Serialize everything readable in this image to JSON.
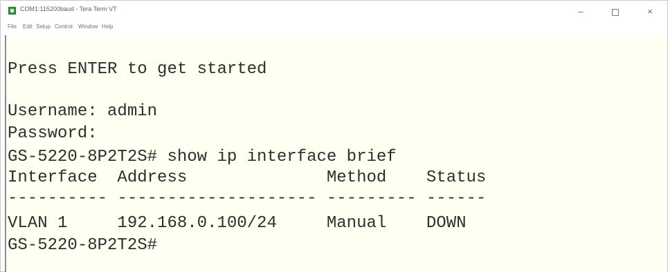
{
  "window": {
    "title": "COM1:115200baud - Tera Term VT",
    "minimize_glyph": "–",
    "close_glyph": "×"
  },
  "menu": {
    "items": [
      "File",
      "Edit",
      "Setup",
      "Control",
      "Window",
      "Help"
    ]
  },
  "terminal": {
    "lines": [
      "Press ENTER to get started",
      "",
      "Username: admin",
      "Password:",
      "GS-5220-8P2T2S# show ip interface brief",
      "Interface  Address              Method    Status",
      "---------- -------------------- --------- ------",
      "VLAN 1     192.168.0.100/24     Manual    DOWN",
      "GS-5220-8P2T2S#"
    ]
  }
}
